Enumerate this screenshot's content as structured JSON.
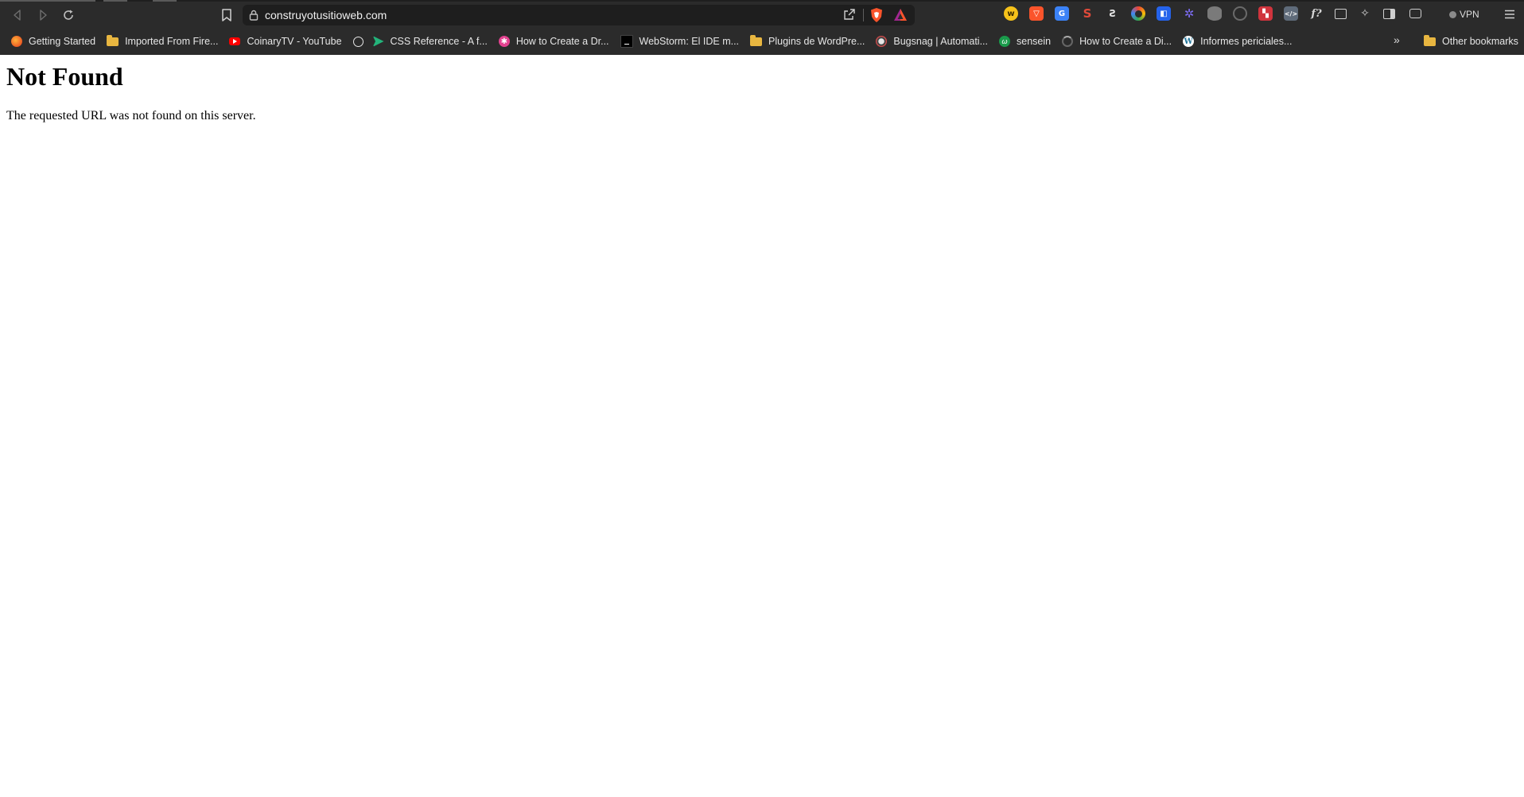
{
  "browser": {
    "url": "construyotusitioweb.com",
    "vpn_label": "VPN",
    "bookmarks": [
      {
        "label": "Getting Started",
        "icon": "firefox-icon"
      },
      {
        "label": "Imported From Fire...",
        "icon": "folder-icon"
      },
      {
        "label": "CoinaryTV - YouTube",
        "icon": "youtube-icon"
      },
      {
        "label": "",
        "icon": "globe-icon"
      },
      {
        "label": "CSS Reference - A f...",
        "icon": "css-reference-icon"
      },
      {
        "label": "How to Create a Dr...",
        "icon": "flower-icon"
      },
      {
        "label": "WebStorm: El IDE m...",
        "icon": "webstorm-icon"
      },
      {
        "label": "Plugins de WordPre...",
        "icon": "folder-icon"
      },
      {
        "label": "Bugsnag | Automati...",
        "icon": "bugsnag-icon"
      },
      {
        "label": "sensein",
        "icon": "sensein-icon"
      },
      {
        "label": "How to Create a Di...",
        "icon": "spinner-icon"
      },
      {
        "label": "Informes periciales...",
        "icon": "wordpress-icon"
      }
    ],
    "overflow_label": "»",
    "other_bookmarks_label": "Other bookmarks",
    "colors": {
      "chrome_bg": "#2b2b2b",
      "omnibox_bg": "#1e1e1e",
      "brave_orange": "#fb542b",
      "folder": "#e8b640"
    }
  },
  "page": {
    "heading": "Not Found",
    "message": "The requested URL was not found on this server."
  }
}
